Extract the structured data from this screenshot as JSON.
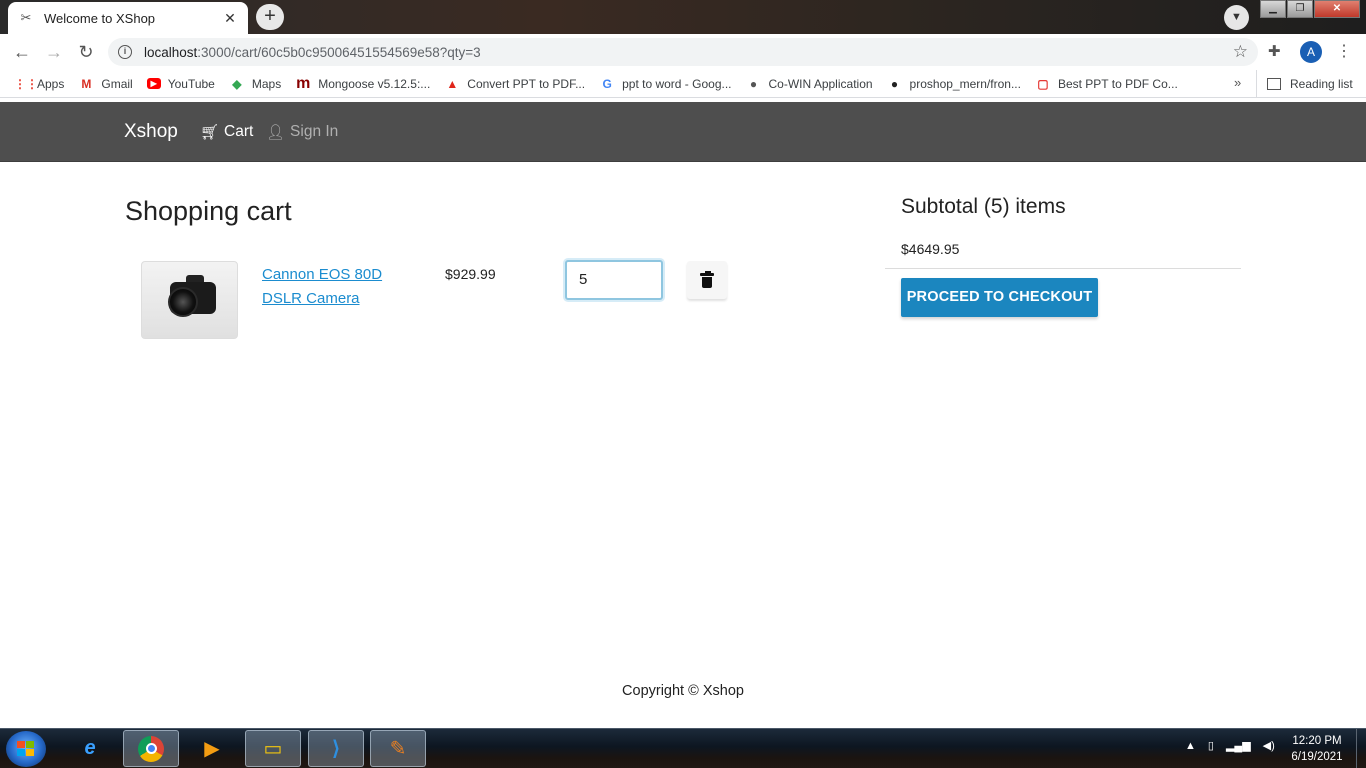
{
  "browser": {
    "tab_title": "Welcome to XShop",
    "tab_close": "✕",
    "new_tab": "+",
    "url_host": "localhost",
    "url_path": ":3000/cart/60c5b0c95006451554569e58?qty=3",
    "avatar_letter": "A",
    "bookmarks": [
      {
        "label": "Apps",
        "icon": "apps-grid-icon",
        "color": "#ea4335"
      },
      {
        "label": "Gmail",
        "icon": "gmail-icon",
        "color": "#d93025"
      },
      {
        "label": "YouTube",
        "icon": "youtube-icon",
        "color": "#ff0000"
      },
      {
        "label": "Maps",
        "icon": "maps-icon",
        "color": "#34a853"
      },
      {
        "label": "Mongoose v5.12.5:...",
        "icon": "mongoose-icon",
        "color": "#880000"
      },
      {
        "label": "Convert PPT to PDF...",
        "icon": "adobe-icon",
        "color": "#e0261b"
      },
      {
        "label": "ppt to word - Goog...",
        "icon": "google-icon",
        "color": "#4285f4"
      },
      {
        "label": "Co-WIN Application",
        "icon": "globe-icon",
        "color": "#555555"
      },
      {
        "label": "proshop_mern/fron...",
        "icon": "github-icon",
        "color": "#222222"
      },
      {
        "label": "Best PPT to PDF Co...",
        "icon": "pdf-icon",
        "color": "#e53935"
      }
    ],
    "bookmarks_more": "»",
    "reading_list": "Reading list"
  },
  "site": {
    "brand": "Xshop",
    "nav_cart": "Cart",
    "nav_signin": "Sign In"
  },
  "cart": {
    "heading": "Shopping cart",
    "items": [
      {
        "name": "Cannon EOS 80D DSLR Camera",
        "price": "$929.99",
        "qty": "5"
      }
    ]
  },
  "summary": {
    "title": "Subtotal (5) items",
    "total": "$4649.95",
    "checkout_label": "PROCEED TO CHECKOUT"
  },
  "footer": {
    "copyright": "Copyright © Xshop"
  },
  "taskbar": {
    "time": "12:20 PM",
    "date": "6/19/2021"
  },
  "colors": {
    "navbar_bg": "#4e4e4e",
    "link": "#1b8ccf",
    "checkout_bg": "#1b86bf"
  }
}
